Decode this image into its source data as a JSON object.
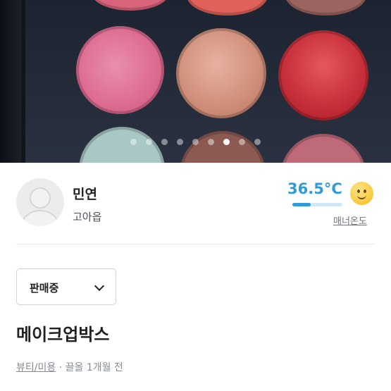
{
  "carousel": {
    "dot_count": 9,
    "active_index": 6
  },
  "seller": {
    "name": "민연",
    "region": "고아읍",
    "manner_temp": "36.5°C",
    "manner_temp_fraction": 0.365,
    "manner_label": "매너온도",
    "temp_color": "#319ad9",
    "temp_icon": "smiley-face-icon"
  },
  "status": {
    "selected": "판매중"
  },
  "post": {
    "title": "메이크업박스",
    "category": "뷰티/미용",
    "separator": "·",
    "bump_time": "끌올 1개월 전"
  }
}
